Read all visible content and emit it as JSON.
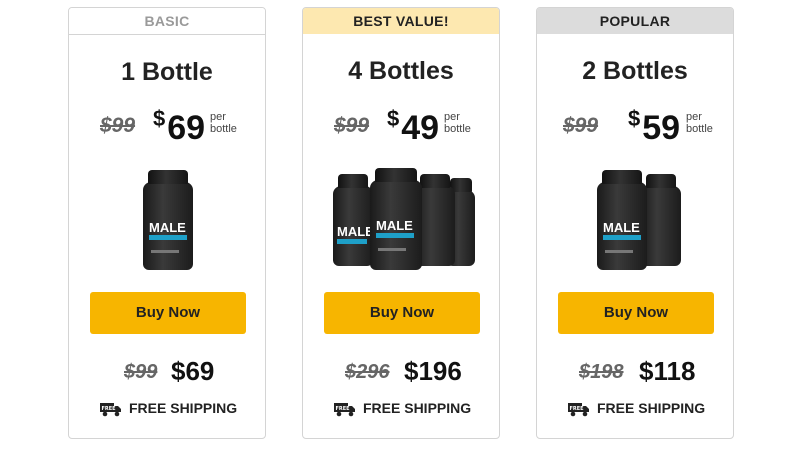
{
  "offers": [
    {
      "badge": "BASIC",
      "title": "1 Bottle",
      "old_price": "$99",
      "price_symbol": "$",
      "price": "69",
      "per_line1": "per",
      "per_line2": "bottle",
      "bottle_label": "MALE",
      "buy_label": "Buy Now",
      "total_old": "$99",
      "total_new": "$69",
      "shipping": "FREE SHIPPING",
      "truck_text": "FREE"
    },
    {
      "badge": "BEST VALUE!",
      "title": "4 Bottles",
      "old_price": "$99",
      "price_symbol": "$",
      "price": "49",
      "per_line1": "per",
      "per_line2": "bottle",
      "bottle_label": "MALE",
      "buy_label": "Buy Now",
      "total_old": "$296",
      "total_new": "$196",
      "shipping": "FREE SHIPPING",
      "truck_text": "FREE"
    },
    {
      "badge": "POPULAR",
      "title": "2 Bottles",
      "old_price": "$99",
      "price_symbol": "$",
      "price": "59",
      "per_line1": "per",
      "per_line2": "bottle",
      "bottle_label": "MALE",
      "buy_label": "Buy Now",
      "total_old": "$198",
      "total_new": "$118",
      "shipping": "FREE SHIPPING",
      "truck_text": "FREE"
    }
  ],
  "colors": {
    "button": "#f7b500",
    "best_badge_bg": "#fde8b0",
    "popular_badge_bg": "#dcdcdc",
    "basic_badge_text": "#9a9a9a"
  }
}
